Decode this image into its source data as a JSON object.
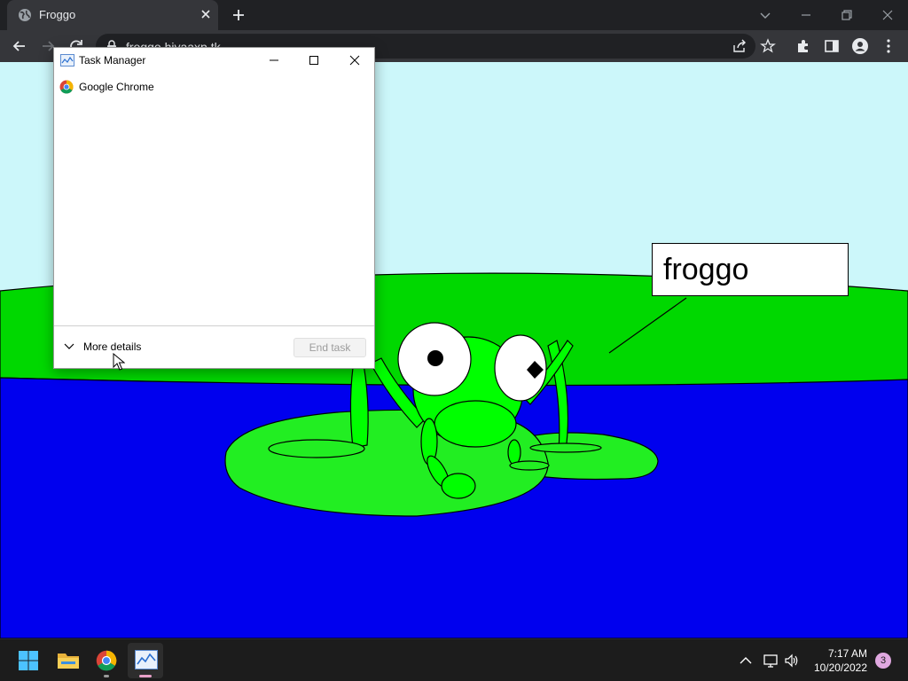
{
  "browser": {
    "tab": {
      "title": "Froggo"
    },
    "address": {
      "url": "froggo.hiyaaxp.tk"
    }
  },
  "page": {
    "speech_text": "froggo"
  },
  "task_manager": {
    "title": "Task Manager",
    "processes": [
      {
        "name": "Google Chrome",
        "icon": "chrome-icon"
      }
    ],
    "more_details_label": "More details",
    "end_task_label": "End task"
  },
  "taskbar": {
    "apps": [
      "start-icon",
      "file-explorer-icon",
      "chrome-icon",
      "task-manager-icon"
    ],
    "clock": {
      "time": "7:17 AM",
      "date": "10/20/2022"
    },
    "notification_count": "3"
  },
  "colors": {
    "sky": "#ccf7fa",
    "grass": "#00d800",
    "water": "#0000ee",
    "frog": "#00ff00",
    "lily_pad": "#22ee22"
  }
}
